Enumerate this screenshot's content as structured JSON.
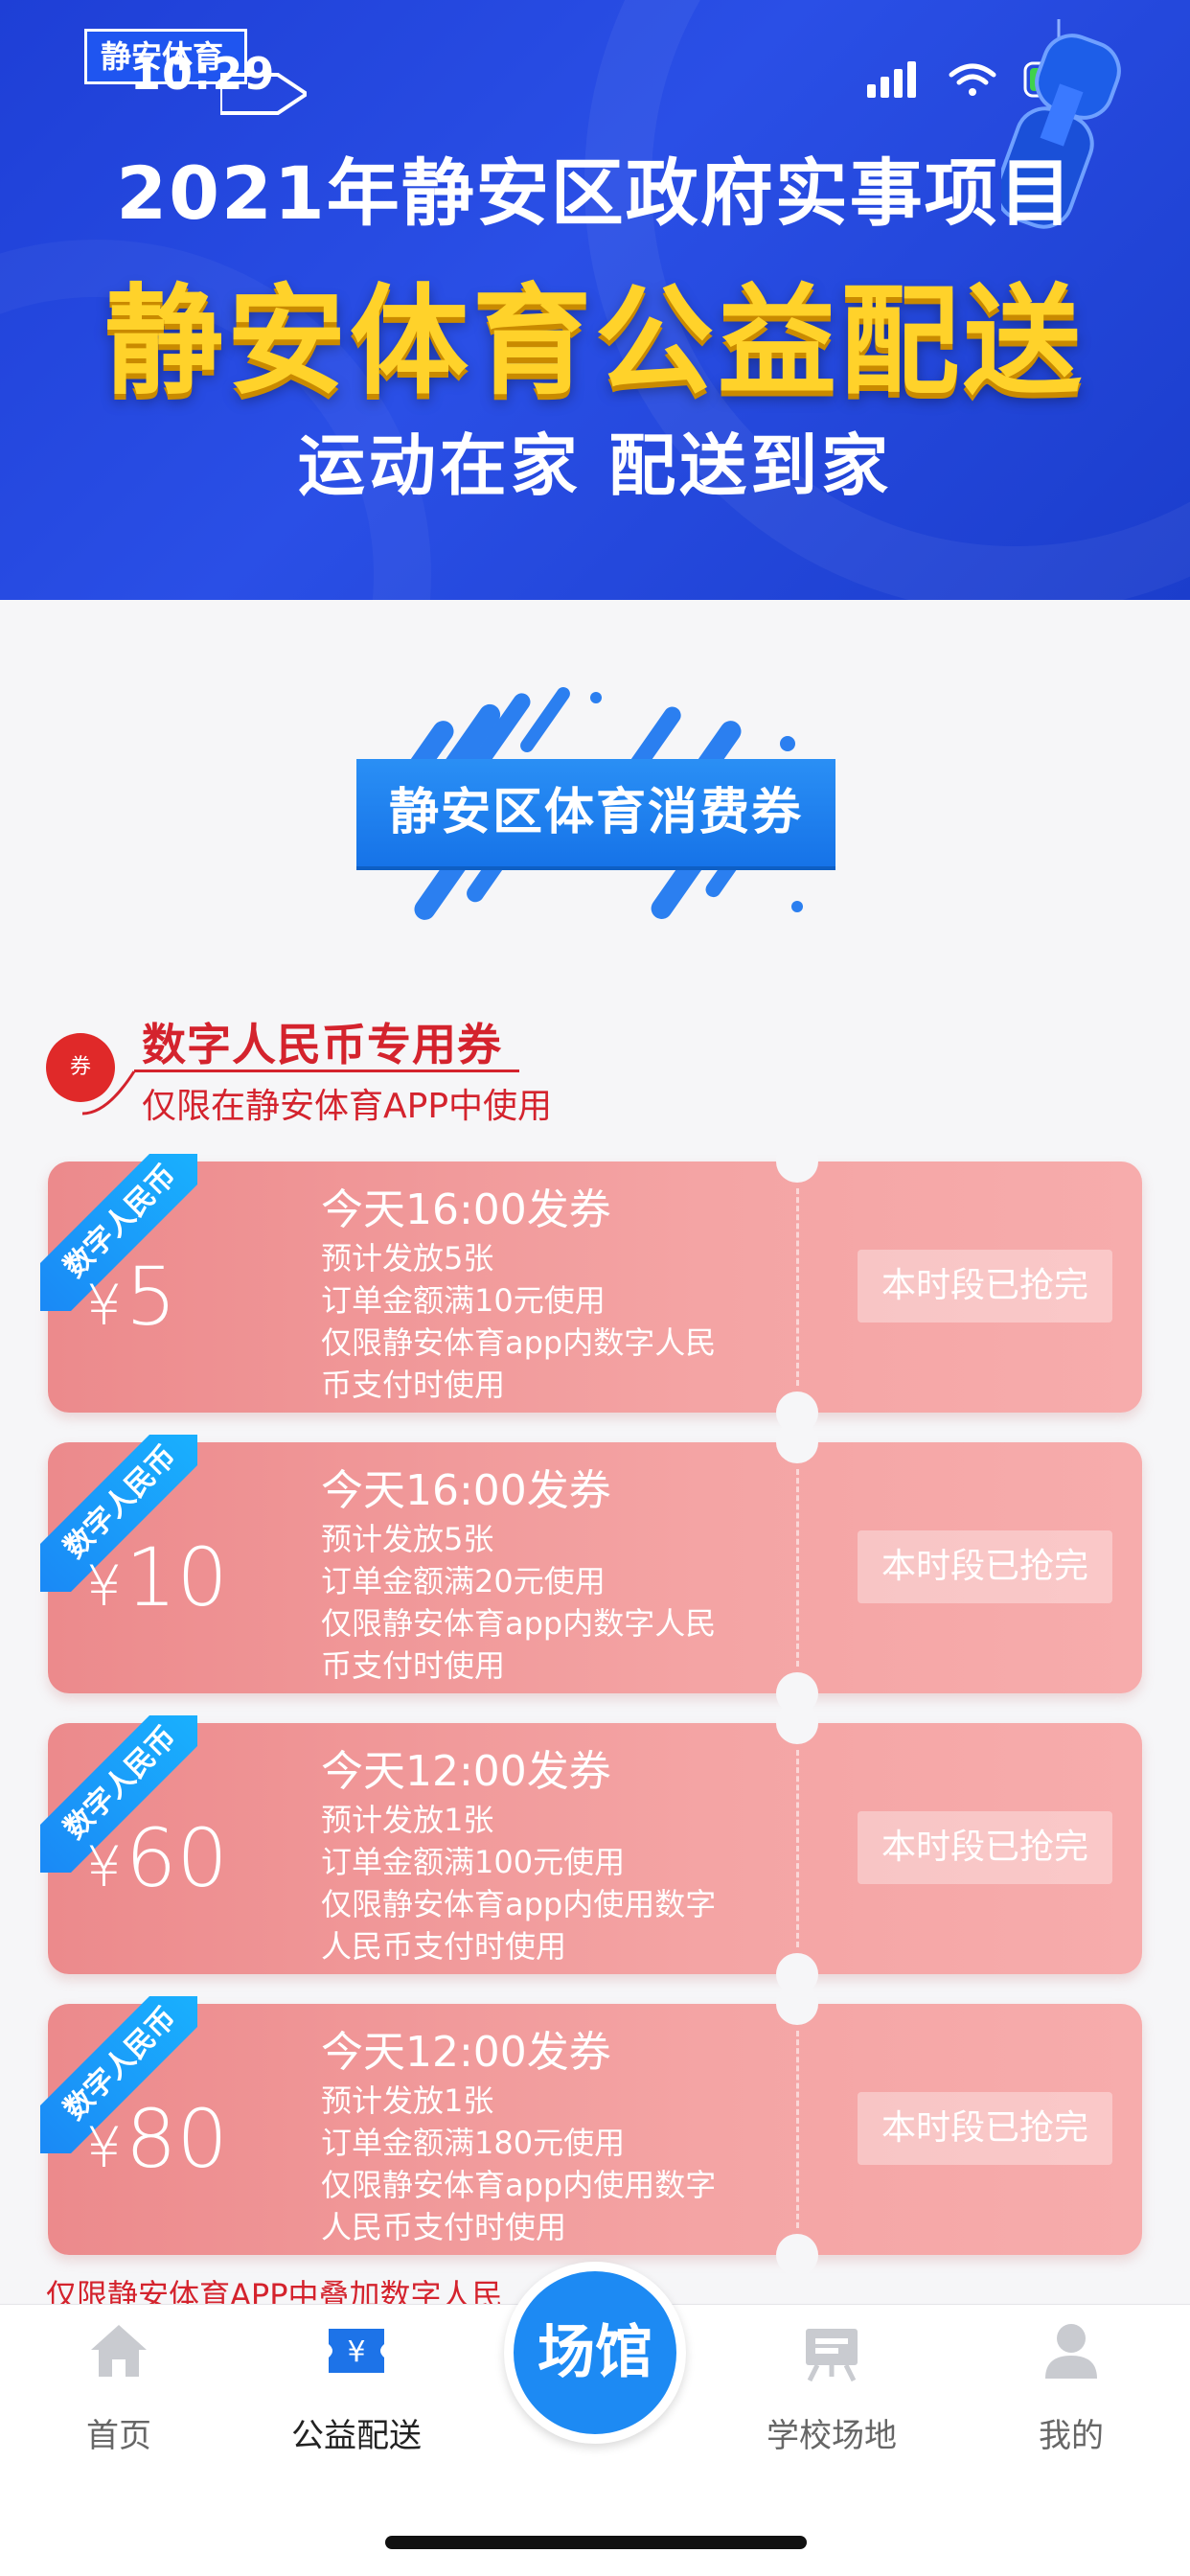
{
  "status_bar": {
    "time": "10:29"
  },
  "banner": {
    "logo_text": "静安体育",
    "title_line1": "2021年静安区政府实事项目",
    "title_line2": "静安体育公益配送",
    "title_line3": "运动在家 配送到家"
  },
  "section": {
    "title": "静安区体育消费券"
  },
  "digital_coin": {
    "badge": "券",
    "title": "数字人民币专用券",
    "subtitle": "仅限在静安体育APP中使用"
  },
  "coupons": [
    {
      "ribbon": "数字人民币",
      "currency": "¥",
      "amount": "5",
      "time": "今天16:00发券",
      "line1": "预计发放5张",
      "line2": "订单金额满10元使用",
      "line3": "仅限静安体育app内数字人民",
      "line4": "币支付时使用",
      "status": "本时段已抢完"
    },
    {
      "ribbon": "数字人民币",
      "currency": "¥",
      "amount": "10",
      "time": "今天16:00发券",
      "line1": "预计发放5张",
      "line2": "订单金额满20元使用",
      "line3": "仅限静安体育app内数字人民",
      "line4": "币支付时使用",
      "status": "本时段已抢完"
    },
    {
      "ribbon": "数字人民币",
      "currency": "¥",
      "amount": "60",
      "time": "今天12:00发券",
      "line1": "预计发放1张",
      "line2": "订单金额满100元使用",
      "line3": "仅限静安体育app内使用数字",
      "line4": "人民币支付时使用",
      "status": "本时段已抢完"
    },
    {
      "ribbon": "数字人民币",
      "currency": "¥",
      "amount": "80",
      "time": "今天12:00发券",
      "line1": "预计发放1张",
      "line2": "订单金额满180元使用",
      "line3": "仅限静安体育app内使用数字",
      "line4": "人民币支付时使用",
      "status": "本时段已抢完"
    }
  ],
  "bottom_note": "仅限静安体育APP中叠加数字人民",
  "tabbar": {
    "home": "首页",
    "welfare": "公益配送",
    "venue_center": "场馆",
    "school": "学校场地",
    "mine": "我的"
  },
  "colors": {
    "banner_blue": "#2348e0",
    "title_yellow": "#ffd22a",
    "accent_red": "#d4232d",
    "coupon_pink": "#f4a4a4",
    "button_blue": "#1d8af3"
  }
}
